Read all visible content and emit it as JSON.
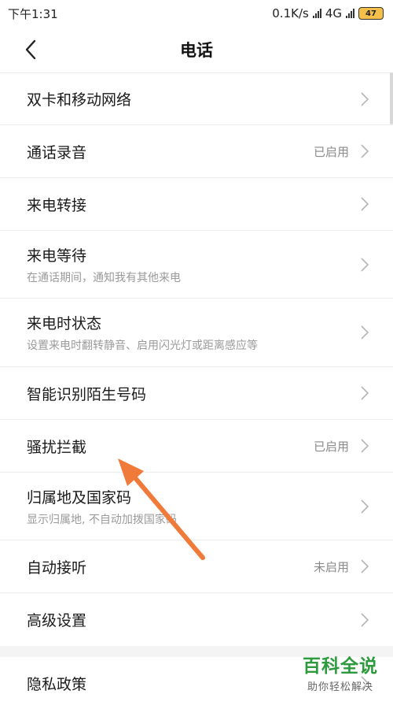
{
  "status": {
    "time": "下午1:31",
    "net_speed": "0.1K/s",
    "network": "4G",
    "battery": "47"
  },
  "header": {
    "title": "电话"
  },
  "icons": {
    "back": "back-chevron-icon",
    "row_arrow": "chevron-right-icon",
    "pointer": "orange-arrow-annotation"
  },
  "colors": {
    "annotation_arrow": "#f07a3a",
    "watermark_green": "#2e9a3e"
  },
  "settings": [
    {
      "label": "双卡和移动网络",
      "sub": "",
      "value": ""
    },
    {
      "label": "通话录音",
      "sub": "",
      "value": "已启用"
    },
    {
      "label": "来电转接",
      "sub": "",
      "value": ""
    },
    {
      "label": "来电等待",
      "sub": "在通话期间，通知我有其他来电",
      "value": ""
    },
    {
      "label": "来电时状态",
      "sub": "设置来电时翻转静音、启用闪光灯或距离感应等",
      "value": ""
    },
    {
      "label": "智能识别陌生号码",
      "sub": "",
      "value": ""
    },
    {
      "label": "骚扰拦截",
      "sub": "",
      "value": "已启用"
    },
    {
      "label": "归属地及国家码",
      "sub": "显示归属地, 不自动加拨国家码",
      "value": ""
    },
    {
      "label": "自动接听",
      "sub": "",
      "value": "未启用"
    },
    {
      "label": "高级设置",
      "sub": "",
      "value": ""
    }
  ],
  "privacy": {
    "label": "隐私政策"
  },
  "watermark": {
    "title": "百科全说",
    "subtitle": "助你轻松解决"
  }
}
